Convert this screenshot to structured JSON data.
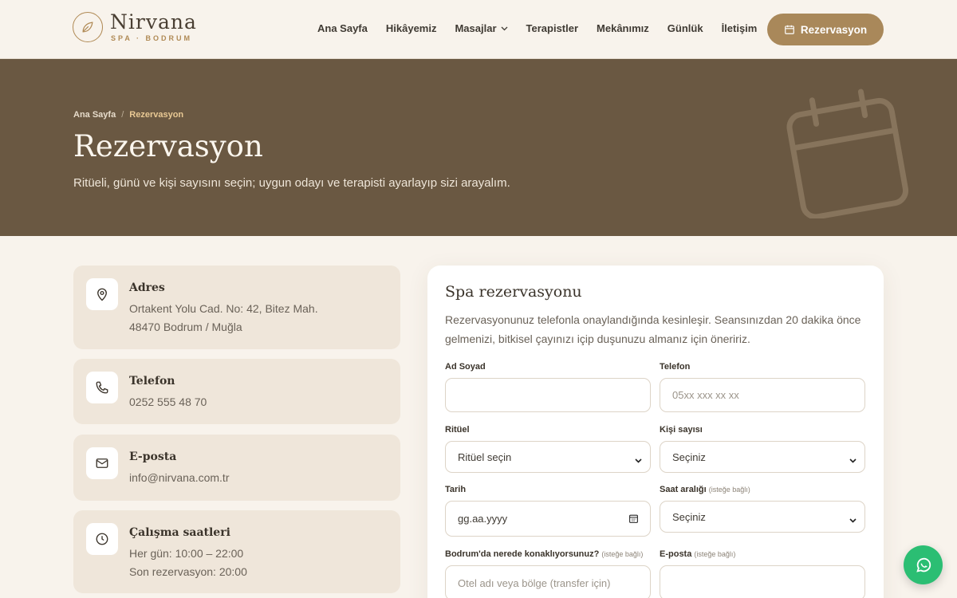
{
  "brand": {
    "name": "Nirvana",
    "tagline": "SPA · BODRUM",
    "accent": "#a9885a",
    "hero_bg": "#6a5842",
    "page_bg": "#f8f3ec"
  },
  "nav": {
    "items": [
      "Ana Sayfa",
      "Hikâyemiz",
      "Masajlar",
      "Terapistler",
      "Mekânımız",
      "Günlük",
      "İletişim"
    ],
    "reserve_button": "Rezervasyon"
  },
  "hero": {
    "breadcrumb": [
      "Ana Sayfa",
      "Rezervasyon"
    ],
    "breadcrumb_sep": "/",
    "title": "Rezervasyon",
    "subtitle": "Ritüeli, günü ve kişi sayısını seçin; uygun odayı ve terapisti ayarlayıp sizi arayalım."
  },
  "info": {
    "address": {
      "title": "Adres",
      "lines": [
        "Ortakent Yolu Cad. No: 42, Bitez Mah.",
        "48470 Bodrum / Muğla"
      ],
      "icon": "map-pin-icon"
    },
    "phone": {
      "title": "Telefon",
      "lines": [
        "0252 555 48 70"
      ],
      "icon": "phone-icon"
    },
    "email": {
      "title": "E-posta",
      "lines": [
        "info@nirvana.com.tr"
      ],
      "icon": "mail-icon"
    },
    "hours": {
      "title": "Çalışma saatleri",
      "lines": [
        "Her gün: 10:00 – 22:00",
        "Son rezervasyon: 20:00"
      ],
      "icon": "clock-icon"
    }
  },
  "form": {
    "title": "Spa rezervasyonu",
    "intro": "Rezervasyonunuz telefonla onaylandığında kesinleşir. Seansınızdan 20 dakika önce gelmenizi, bitkisel çayınızı içip duşunuzu almanız için öneririz.",
    "optional": "(isteğe bağlı)",
    "name": {
      "label": "Ad Soyad",
      "value": ""
    },
    "phone": {
      "label": "Telefon",
      "placeholder": "05xx xxx xx xx"
    },
    "ritual": {
      "label": "Ritüel",
      "selected": "Ritüel seçin"
    },
    "guests": {
      "label": "Kişi sayısı",
      "selected": "Seçiniz"
    },
    "date": {
      "label": "Tarih",
      "placeholder": "gg.aa.yyyy"
    },
    "time": {
      "label": "Saat aralığı",
      "selected": "Seçiniz"
    },
    "stay": {
      "label": "Bodrum'da nerede konaklıyorsunuz?",
      "placeholder": "Otel adı veya bölge (transfer için)"
    },
    "email": {
      "label": "E-posta",
      "value": ""
    }
  }
}
